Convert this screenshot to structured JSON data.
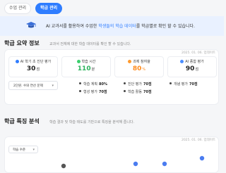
{
  "tabs": [
    {
      "label": "수업 관리",
      "active": false
    },
    {
      "label": "학급 관리",
      "active": true
    }
  ],
  "banner": {
    "pre": "AI 교과서를 활용하여 수업한 ",
    "highlight": "학생들의 학습 데이터",
    "post": "를 학급별로 확인 할 수 있습니다."
  },
  "summary": {
    "title": "학급 요약 정보",
    "description": "교과서 전체에 대한 학습 데이터를 확인 할 수 있습니다.",
    "updated": "2025. 01. 06. 업데이트",
    "stats": [
      {
        "label": "AI 학기 초 진단 평가",
        "value": "30",
        "unit": "점",
        "color": "#2f7dff",
        "value_color": "#222"
      },
      {
        "label": "학습 시간",
        "value": "110",
        "unit": "분",
        "color": "#3ccf6e",
        "value_color": "#2bb35c"
      },
      {
        "label": "과제 참여율",
        "value": "80",
        "unit": "%",
        "color": "#ff9a2e",
        "value_color": "#ff8a1a"
      },
      {
        "label": "AI 종합 평가",
        "value": "90",
        "unit": "점",
        "color": "#4a8dff",
        "value_color": "#222"
      }
    ],
    "select_value": "2단원. 수와 연산 문제",
    "metrics_row1": [
      {
        "label": "학습 계획",
        "value": "80%"
      },
      {
        "label": "진단 평가",
        "value": "70점"
      },
      {
        "label": "개념 평가",
        "value": "70점"
      }
    ],
    "metrics_row2": [
      {
        "label": "형성 평가",
        "value": "70점"
      },
      {
        "label": "학습 활동",
        "value": "70점"
      }
    ]
  },
  "analysis": {
    "title": "학급 특징 분석",
    "description": "학습 결과 및 학습 태도를 기반으로 특징을 분석해 줍니다.",
    "updated": "2025. 01. 06. 업데이트",
    "dropdown_value": "학습 수준"
  }
}
